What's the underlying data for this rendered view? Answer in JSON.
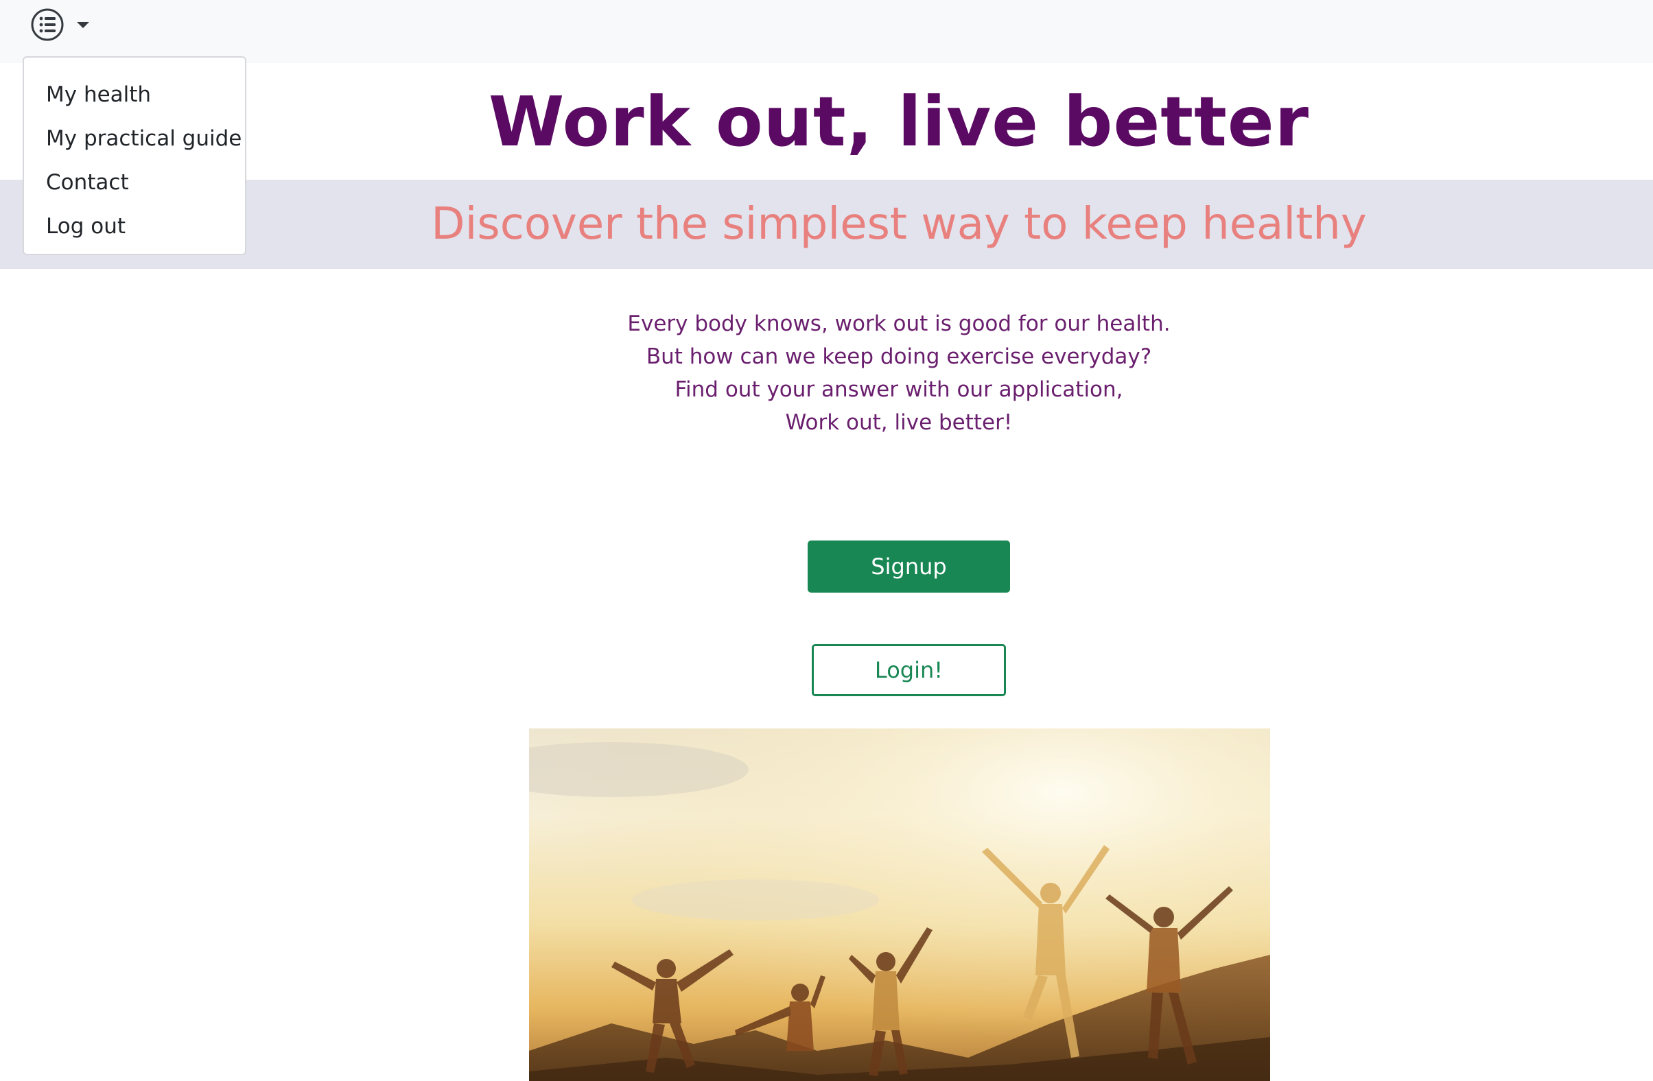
{
  "nav": {
    "menu_icon": "list-icon",
    "caret_icon": "caret-down-icon",
    "items": [
      {
        "label": "My health"
      },
      {
        "label": "My practical guide"
      },
      {
        "label": "Contact"
      },
      {
        "label": "Log out"
      }
    ]
  },
  "hero": {
    "title": "Work out, live better",
    "subtitle": "Discover the simplest way to keep healthy"
  },
  "intro": {
    "lines": [
      "Every body knows, work out is good for our health.",
      "But how can we keep doing exercise everyday?",
      "Find out your answer with our application,",
      "Work out, live better!"
    ]
  },
  "actions": {
    "signup_label": "Signup",
    "login_label": "Login!"
  },
  "colors": {
    "title": "#5b0a63",
    "subtitle": "#e8807e",
    "banner_bg": "#e3e3ee",
    "intro_text": "#6a1f6e",
    "success": "#198754"
  }
}
